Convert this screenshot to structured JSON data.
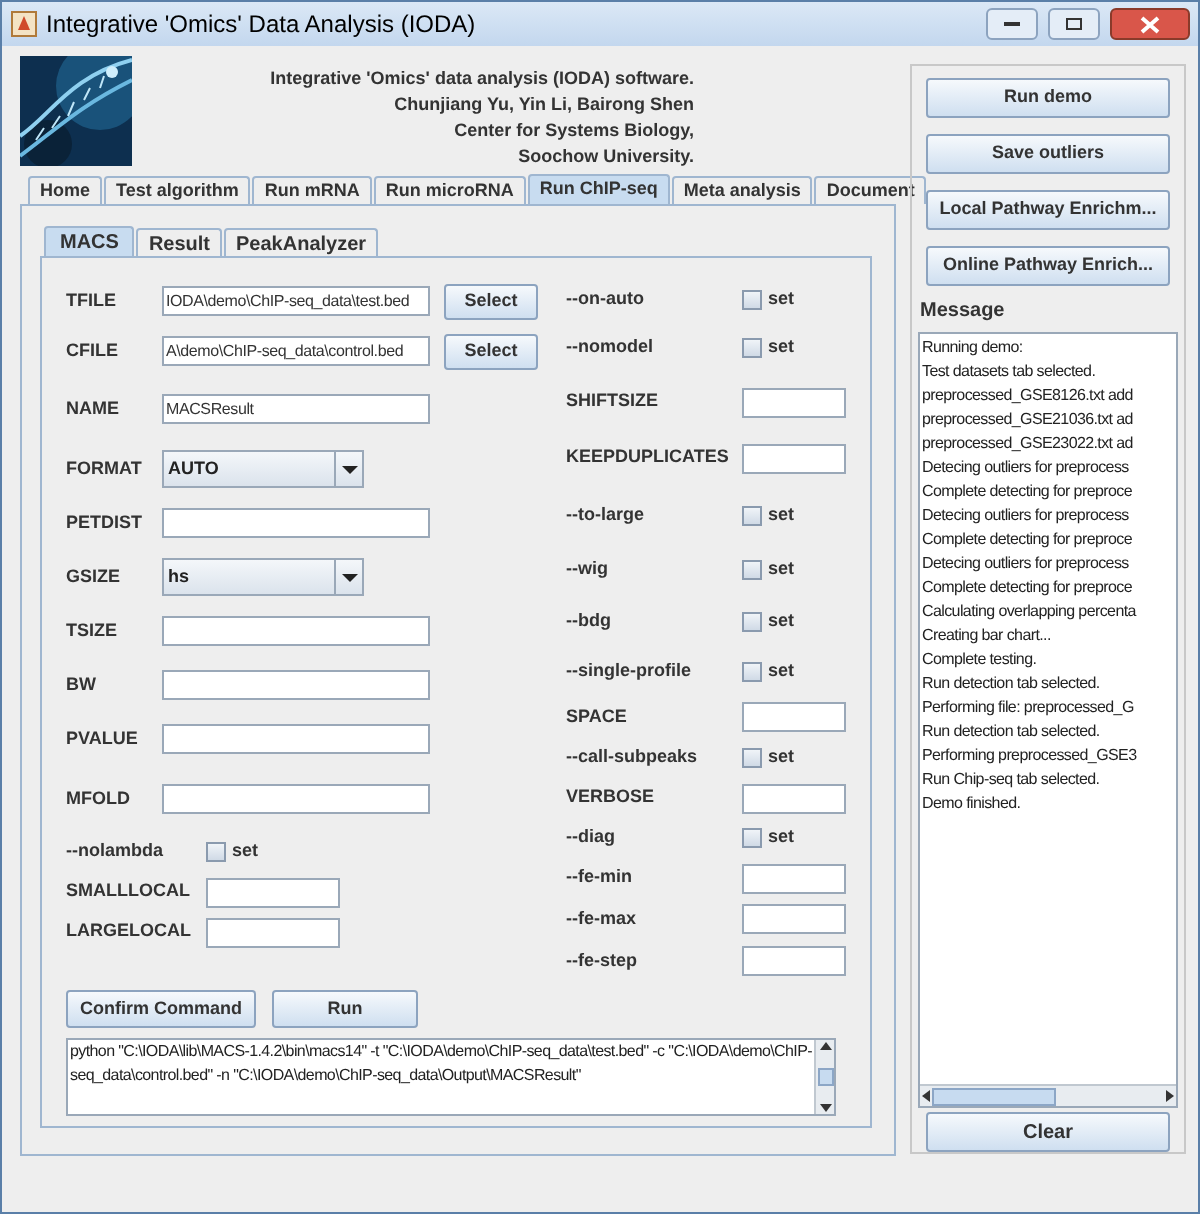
{
  "window": {
    "title": "Integrative 'Omics' Data Analysis (IODA)"
  },
  "header": {
    "lines": [
      "Integrative 'Omics' data analysis (IODA) software.",
      "Chunjiang Yu, Yin Li, Bairong Shen",
      "Center for Systems Biology,",
      "Soochow University."
    ]
  },
  "tabs": [
    {
      "label": "Home",
      "selected": false
    },
    {
      "label": "Test algorithm",
      "selected": false
    },
    {
      "label": "Run mRNA",
      "selected": false
    },
    {
      "label": "Run microRNA",
      "selected": false
    },
    {
      "label": "Run ChIP-seq",
      "selected": true
    },
    {
      "label": "Meta analysis",
      "selected": false
    },
    {
      "label": "Document",
      "selected": false
    }
  ],
  "subtabs": [
    {
      "label": "MACS",
      "selected": true
    },
    {
      "label": "Result",
      "selected": false
    },
    {
      "label": "PeakAnalyzer",
      "selected": false
    }
  ],
  "left_fields": [
    {
      "kind": "file",
      "label": "TFILE",
      "value": "IODA\\demo\\ChIP-seq_data\\test.bed",
      "button": "Select"
    },
    {
      "kind": "file",
      "label": "CFILE",
      "value": "A\\demo\\ChIP-seq_data\\control.bed",
      "button": "Select"
    },
    {
      "kind": "text",
      "label": "NAME",
      "value": "MACSResult"
    },
    {
      "kind": "combo",
      "label": "FORMAT",
      "value": "AUTO"
    },
    {
      "kind": "text",
      "label": "PETDIST"
    },
    {
      "kind": "combo",
      "label": "GSIZE",
      "value": "hs"
    },
    {
      "kind": "text",
      "label": "TSIZE"
    },
    {
      "kind": "text",
      "label": "BW"
    },
    {
      "kind": "text",
      "label": "PVALUE"
    },
    {
      "kind": "text",
      "label": "MFOLD"
    },
    {
      "kind": "checkbox",
      "label": "--nolambda",
      "text": "set",
      "checked": false
    },
    {
      "kind": "short",
      "label": "SMALLLOCAL"
    },
    {
      "kind": "short",
      "label": "LARGELOCAL"
    }
  ],
  "right_fields": [
    {
      "kind": "checkbox",
      "label": "--on-auto",
      "text": "set",
      "checked": false
    },
    {
      "kind": "checkbox",
      "label": "--nomodel",
      "text": "set",
      "checked": false
    },
    {
      "kind": "text",
      "label": "SHIFTSIZE"
    },
    {
      "kind": "text",
      "label": "KEEPDUPLICATES"
    },
    {
      "kind": "checkbox",
      "label": "--to-large",
      "text": "set",
      "checked": false
    },
    {
      "kind": "checkbox",
      "label": "--wig",
      "text": "set",
      "checked": false
    },
    {
      "kind": "checkbox",
      "label": "--bdg",
      "text": "set",
      "checked": false
    },
    {
      "kind": "checkbox",
      "label": "--single-profile",
      "text": "set",
      "checked": false
    },
    {
      "kind": "text",
      "label": "SPACE"
    },
    {
      "kind": "checkbox",
      "label": "--call-subpeaks",
      "text": "set",
      "checked": false
    },
    {
      "kind": "text",
      "label": "VERBOSE"
    },
    {
      "kind": "checkbox",
      "label": "--diag",
      "text": "set",
      "checked": false
    },
    {
      "kind": "text",
      "label": "--fe-min"
    },
    {
      "kind": "text",
      "label": "--fe-max"
    },
    {
      "kind": "text",
      "label": "--fe-step"
    }
  ],
  "actions": [
    "Confirm Command",
    "Run"
  ],
  "command": "python \"C:\\IODA\\lib\\MACS-1.4.2\\bin\\macs14\" -t \"C:\\IODA\\demo\\ChIP-seq_data\\test.bed\" -c \"C:\\IODA\\demo\\ChIP-seq_data\\control.bed\" -n \"C:\\IODA\\demo\\ChIP-seq_data\\Output\\MACSResult\"",
  "side_buttons": [
    "Run demo",
    "Save outliers",
    "Local Pathway Enrichm...",
    "Online Pathway Enrich..."
  ],
  "message": {
    "title": "Message",
    "lines": [
      "Running demo:",
      "Test datasets tab selected.",
      "preprocessed_GSE8126.txt add",
      "preprocessed_GSE21036.txt ad",
      "preprocessed_GSE23022.txt ad",
      "Detecing outliers for preprocess",
      "Complete detecting for preproce",
      "Detecing outliers for preprocess",
      "Complete detecting for preproce",
      "Detecing outliers for preprocess",
      "Complete detecting for preproce",
      "Calculating overlapping percenta",
      "Creating bar chart...",
      "Complete testing.",
      "Run detection tab selected.",
      "Performing file: preprocessed_G",
      "Run detection tab selected.",
      "Performing preprocessed_GSE3",
      "Run Chip-seq tab selected.",
      "Demo finished."
    ],
    "button": "Clear"
  }
}
